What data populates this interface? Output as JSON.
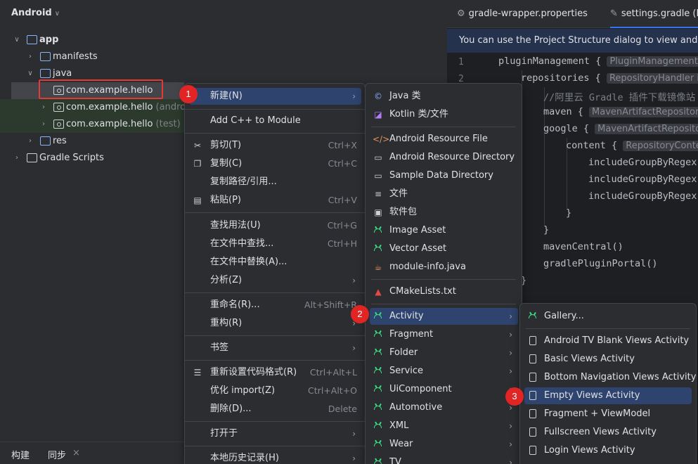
{
  "project": {
    "header": "Android",
    "tree": [
      {
        "label": "app",
        "suffix": ""
      },
      {
        "label": "manifests",
        "suffix": ""
      },
      {
        "label": "java",
        "suffix": ""
      },
      {
        "label": "com.example.hello",
        "suffix": ""
      },
      {
        "label": "com.example.hello",
        "suffix": "(androidT"
      },
      {
        "label": "com.example.hello",
        "suffix": "(test)"
      },
      {
        "label": "res",
        "suffix": ""
      },
      {
        "label": "Gradle Scripts",
        "suffix": ""
      }
    ],
    "bottom_tabs": [
      "构建",
      "同步"
    ],
    "close_glyph": "×"
  },
  "editor": {
    "tabs": [
      "gradle-wrapper.properties",
      "settings.gradle (H"
    ],
    "banner": "You can use the Project Structure dialog to view and edit y",
    "line_numbers": [
      "1",
      "2"
    ],
    "code": [
      {
        "text": "pluginManagement {",
        "hint": "PluginManagement"
      },
      {
        "text": "repositories {",
        "hint": "RepositoryHandler i"
      },
      {
        "text": "//阿里云 Gradle 插件下载镜像站",
        "hint": ""
      },
      {
        "text": "maven {",
        "hint": "MavenArtifactRepositor"
      },
      {
        "text": "google {",
        "hint": "MavenArtifactRepositor"
      },
      {
        "text": "content {",
        "hint": "RepositoryConte"
      },
      {
        "text": "includeGroupByRegex(",
        "hint": ""
      },
      {
        "text": "includeGroupByRegex(",
        "hint": ""
      },
      {
        "text": "includeGroupByRegex(",
        "hint": ""
      },
      {
        "text": "}",
        "hint": ""
      },
      {
        "text": "}",
        "hint": ""
      },
      {
        "text": "mavenCentral()",
        "hint": ""
      },
      {
        "text": "gradlePluginPortal()",
        "hint": ""
      },
      {
        "text": "}",
        "hint": ""
      }
    ]
  },
  "context_menu": {
    "items": [
      {
        "label": "新建(N)",
        "shortcut": ""
      },
      {
        "label": "Add C++ to Module",
        "shortcut": ""
      },
      {
        "label": "剪切(T)",
        "shortcut": "Ctrl+X"
      },
      {
        "label": "复制(C)",
        "shortcut": "Ctrl+C"
      },
      {
        "label": "复制路径/引用...",
        "shortcut": ""
      },
      {
        "label": "粘贴(P)",
        "shortcut": "Ctrl+V"
      },
      {
        "label": "查找用法(U)",
        "shortcut": "Ctrl+G"
      },
      {
        "label": "在文件中查找...",
        "shortcut": "Ctrl+H"
      },
      {
        "label": "在文件中替换(A)...",
        "shortcut": ""
      },
      {
        "label": "分析(Z)",
        "shortcut": ""
      },
      {
        "label": "重命名(R)...",
        "shortcut": "Alt+Shift+R"
      },
      {
        "label": "重构(R)",
        "shortcut": ""
      },
      {
        "label": "书签",
        "shortcut": ""
      },
      {
        "label": "重新设置代码格式(R)",
        "shortcut": "Ctrl+Alt+L"
      },
      {
        "label": "优化 import(Z)",
        "shortcut": "Ctrl+Alt+O"
      },
      {
        "label": "删除(D)...",
        "shortcut": "Delete"
      },
      {
        "label": "打开于",
        "shortcut": ""
      },
      {
        "label": "本地历史记录(H)",
        "shortcut": ""
      }
    ]
  },
  "new_submenu": {
    "items": [
      {
        "label": "Java 类",
        "icon": "java-class-icon"
      },
      {
        "label": "Kotlin 类/文件",
        "icon": "kotlin-icon"
      },
      {
        "label": "Android Resource File",
        "icon": "resource-file-icon"
      },
      {
        "label": "Android Resource Directory",
        "icon": "folder-icon"
      },
      {
        "label": "Sample Data Directory",
        "icon": "folder-icon"
      },
      {
        "label": "文件",
        "icon": "file-icon"
      },
      {
        "label": "软件包",
        "icon": "package-icon"
      },
      {
        "label": "Image Asset",
        "icon": "android-icon"
      },
      {
        "label": "Vector Asset",
        "icon": "android-icon"
      },
      {
        "label": "module-info.java",
        "icon": "java-module-icon"
      },
      {
        "label": "CMakeLists.txt",
        "icon": "cmake-icon"
      },
      {
        "label": "Activity",
        "icon": "android-icon"
      },
      {
        "label": "Fragment",
        "icon": "android-icon"
      },
      {
        "label": "Folder",
        "icon": "android-icon"
      },
      {
        "label": "Service",
        "icon": "android-icon"
      },
      {
        "label": "UiComponent",
        "icon": "android-icon"
      },
      {
        "label": "Automotive",
        "icon": "android-icon"
      },
      {
        "label": "XML",
        "icon": "android-icon"
      },
      {
        "label": "Wear",
        "icon": "android-icon"
      },
      {
        "label": "TV",
        "icon": "android-icon"
      }
    ]
  },
  "activity_submenu": {
    "items": [
      {
        "label": "Gallery...",
        "icon": "android-icon"
      },
      {
        "label": "Android TV Blank Views Activity",
        "icon": "file-icon"
      },
      {
        "label": "Basic Views Activity",
        "icon": "file-icon"
      },
      {
        "label": "Bottom Navigation Views Activity",
        "icon": "file-icon"
      },
      {
        "label": "Empty Views Activity",
        "icon": "file-icon"
      },
      {
        "label": "Fragment + ViewModel",
        "icon": "file-icon"
      },
      {
        "label": "Fullscreen Views Activity",
        "icon": "file-icon"
      },
      {
        "label": "Login Views Activity",
        "icon": "file-icon"
      }
    ]
  },
  "badges": [
    "1",
    "2",
    "3"
  ],
  "colors": {
    "accent": "#3574f0",
    "menu_hover": "#2e436e",
    "badge": "#e12525",
    "highlight": "#e53935",
    "android": "#3ddc84"
  }
}
